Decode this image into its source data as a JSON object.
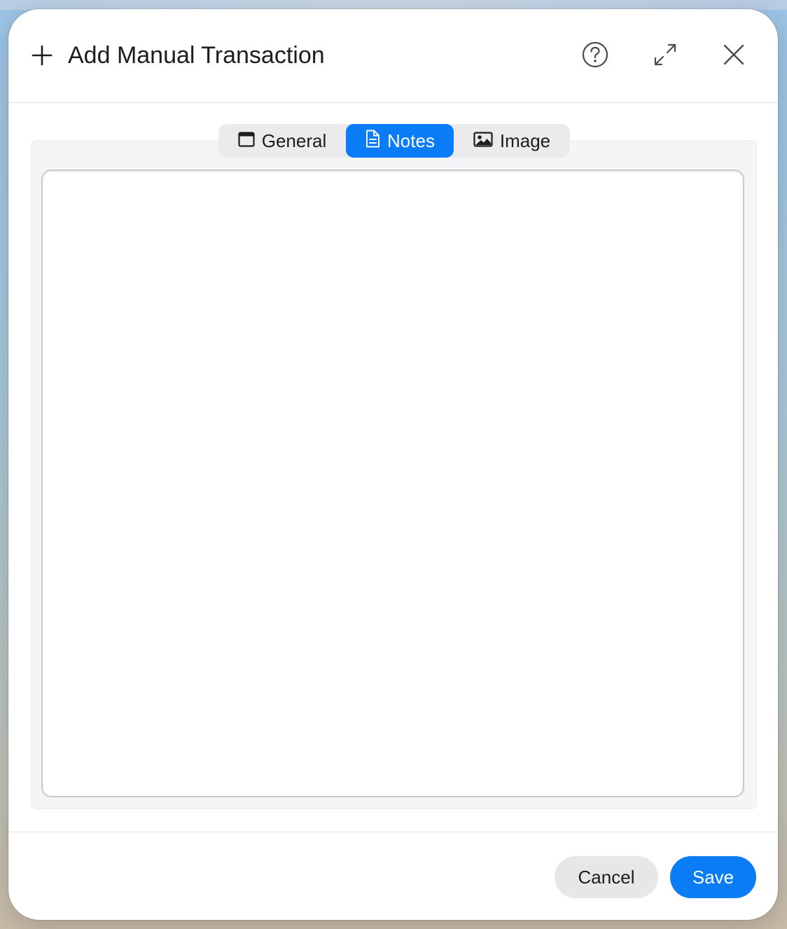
{
  "dialog": {
    "title": "Add Manual Transaction",
    "header_icons": [
      "plus-icon",
      "help-icon",
      "expand-icon",
      "close-icon"
    ]
  },
  "tabs": [
    {
      "label": "General",
      "icon": "window-icon",
      "selected": false
    },
    {
      "label": "Notes",
      "icon": "document-icon",
      "selected": true
    },
    {
      "label": "Image",
      "icon": "image-icon",
      "selected": false
    }
  ],
  "notes": {
    "value": ""
  },
  "footer": {
    "cancel_label": "Cancel",
    "save_label": "Save"
  },
  "colors": {
    "accent": "#0a7cf5",
    "secondary_button": "#e7e7e9",
    "panel_background": "#f5f5f7"
  }
}
